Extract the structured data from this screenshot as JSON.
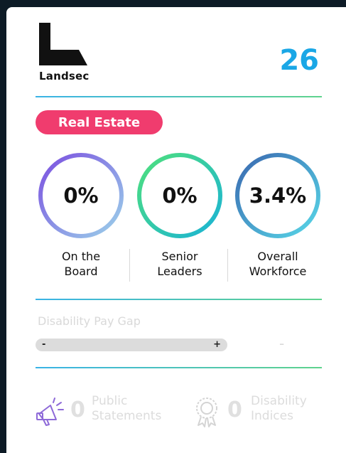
{
  "company": {
    "logo_text": "Landsec",
    "rank": "26",
    "sector": "Real Estate"
  },
  "metrics": [
    {
      "value": "0%",
      "label_line1": "On the",
      "label_line2": "Board"
    },
    {
      "value": "0%",
      "label_line1": "Senior",
      "label_line2": "Leaders"
    },
    {
      "value": "3.4%",
      "label_line1": "Overall",
      "label_line2": "Workforce"
    }
  ],
  "pay_gap": {
    "title": "Disability Pay Gap",
    "minus_label": "-",
    "plus_label": "+",
    "value": "-"
  },
  "stats": [
    {
      "count": "0",
      "line1": "Public",
      "line2": "Statements",
      "icon": "megaphone-icon"
    },
    {
      "count": "0",
      "line1": "Disability",
      "line2": "Indices",
      "icon": "award-rosette-icon"
    }
  ],
  "colors": {
    "background": "#0d1b26",
    "card": "#ffffff",
    "rank": "#1aa7e6",
    "sector_pill": "#f03c6e",
    "ring_board": [
      "#7b4fe0",
      "#9bd2ea"
    ],
    "ring_leaders": [
      "#4fe07c",
      "#1ab3d6"
    ],
    "ring_workforce": [
      "#3a68b0",
      "#58d8e8"
    ],
    "divider": [
      "#3ab3e6",
      "#5fd38d"
    ],
    "muted": "#dcdcdc"
  }
}
